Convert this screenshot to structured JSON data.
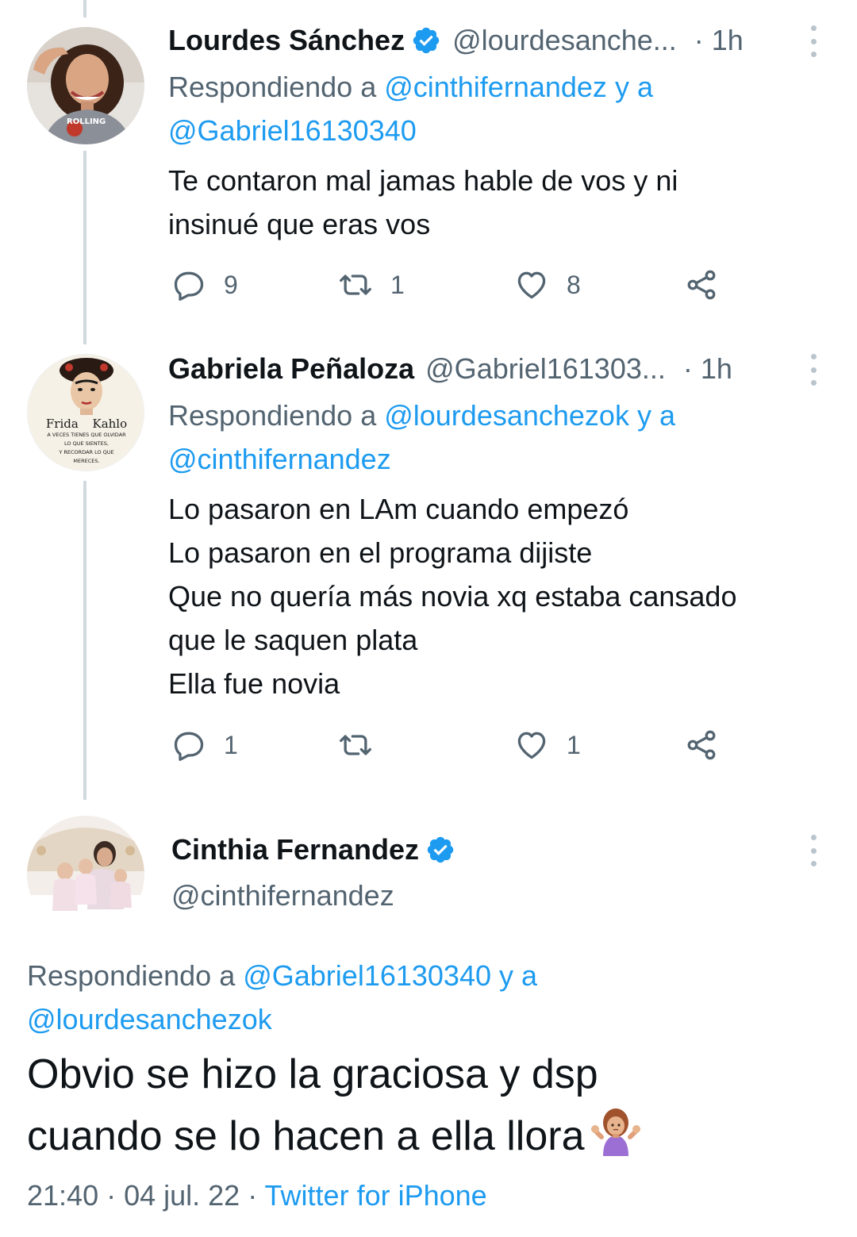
{
  "tweets": [
    {
      "display_name": "Lourdes Sánchez",
      "verified": true,
      "handle": "@lourdesanche...",
      "time": "· 1h",
      "reply_prefix": "Respondiendo a ",
      "reply_mention_1": "@cinthifernandez",
      "reply_joiner": " y a",
      "reply_mention_2": "@Gabriel16130340",
      "text_lines": [
        "Te contaron mal jamas hable de vos y ni",
        "insinué que eras vos"
      ],
      "reply_count": "9",
      "retweet_count": "1",
      "like_count": "8"
    },
    {
      "display_name": "Gabriela Peñaloza",
      "verified": false,
      "handle": "@Gabriel161303...",
      "time": "· 1h",
      "reply_prefix": "Respondiendo a ",
      "reply_mention_1": "@lourdesanchezok",
      "reply_joiner": " y a",
      "reply_mention_2": "@cinthifernandez",
      "text_lines": [
        "Lo pasaron en LAm cuando empezó",
        "Lo pasaron en el programa dijiste",
        "Que no quería más novia xq estaba cansado",
        "que le saquen plata",
        "Ella fue novia"
      ],
      "reply_count": "1",
      "retweet_count": "",
      "like_count": "1",
      "avatar_text": {
        "frida": "Frida",
        "kahlo": "Kahlo",
        "line1": "A VECES TIENES QUE OLVIDAR",
        "line2": "LO QUE SIENTES,",
        "line3": "Y RECORDAR LO QUE",
        "line4": "MERECES."
      }
    }
  ],
  "main_tweet": {
    "display_name": "Cinthia Fernandez",
    "verified": true,
    "handle": "@cinthifernandez",
    "reply_prefix": "Respondiendo a ",
    "reply_mention_1": "@Gabriel16130340",
    "reply_joiner": " y a",
    "reply_mention_2": "@lourdesanchezok",
    "text_line_1": "Obvio se hizo la graciosa y dsp",
    "text_line_2": "cuando se lo hacen a ella llora",
    "emoji": "person-shrugging-emoji",
    "time": "21:40",
    "separator": " · ",
    "date": "04 jul. 22",
    "source": "Twitter for iPhone"
  },
  "colors": {
    "link": "#1d9bf0",
    "secondary_text": "#536471",
    "primary_text": "#0f1419",
    "thread_line": "#cfd9de",
    "verified_badge": "#1d9bf0"
  }
}
